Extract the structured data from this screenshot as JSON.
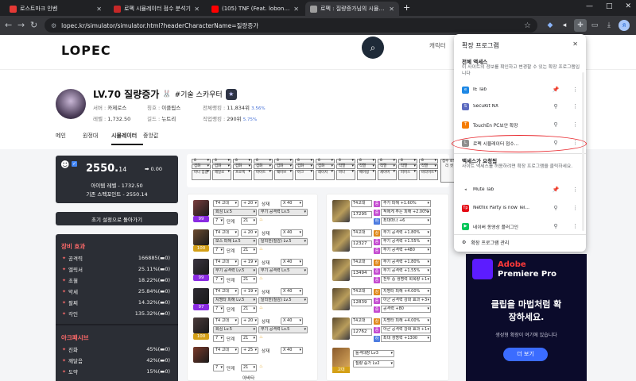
{
  "browser": {
    "tabs": [
      {
        "title": "로스트마크 인벤",
        "active": false,
        "color": "#e53935"
      },
      {
        "title": "로펙 시뮬레이터 점수 분석기",
        "active": false,
        "color": "#c62828"
      },
      {
        "title": "(105) TNF (Feat. lobonabea...",
        "active": false,
        "color": "#ff0000"
      },
      {
        "title": "로펙 : 질량증가님의 시뮬레이터",
        "active": true,
        "color": "#9e9e9e"
      }
    ],
    "url": "lopec.kr/simulator/simulator.html?headerCharacterName=질량증가",
    "new_tab": "+",
    "window_controls": {
      "min": "—",
      "max": "□",
      "close": "✕"
    },
    "profile_initial": "Я"
  },
  "site": {
    "logo": "LOPEC",
    "search_placeholder": "캐릭터"
  },
  "profile": {
    "level_name": "LV.70 질량증가",
    "bunny": "🐰",
    "job": "#기술 스카우터",
    "server_k": "서버 :",
    "server_v": "카제로스",
    "title_k": "칭호 :",
    "title_v": "이클립스",
    "total_k": "전체랭킹 :",
    "total_v": "11,834위",
    "total_pct": "3.56%",
    "level_k": "레벨 :",
    "level_v": "1,732.50",
    "guild_k": "길드 :",
    "guild_v": "뉴트리",
    "job_rank_k": "직업랭킹 :",
    "job_rank_v": "290위",
    "job_rank_pct": "5.75%"
  },
  "nav_tabs": [
    "메인",
    "원정대",
    "시뮬레이터",
    "중앙값"
  ],
  "score_card": {
    "score_int": "2550.",
    "score_dec": "14",
    "delta": "➡ 0.00",
    "item_level": "아이템 레벨 - 1732.50",
    "base_points": "기존 스펙포인트 - 2550.14",
    "checkbox": "✓"
  },
  "reset_button": "초기 설정으로 돌아가기",
  "stats": {
    "equip_title": "장비 효과",
    "equip": [
      {
        "label": "공격력",
        "value": "166885(▬0)"
      },
      {
        "label": "엘릭서",
        "value": "25.11%(▬0)"
      },
      {
        "label": "초월",
        "value": "18.22%(▬0)"
      },
      {
        "label": "악세",
        "value": "25.84%(▬0)"
      },
      {
        "label": "팔찌",
        "value": "14.32%(▬0)"
      },
      {
        "label": "각인",
        "value": "135.32%(▬0)"
      }
    ],
    "ark_title": "아크패시브",
    "ark": [
      {
        "label": "진화",
        "value": "45%(▬0)"
      },
      {
        "label": "깨달음",
        "value": "42%(▬0)"
      },
      {
        "label": "도약",
        "value": "15%(▬0)"
      }
    ]
  },
  "gems": {
    "levels": [
      "8",
      "8",
      "8",
      "8",
      "8",
      "8",
      "8",
      "8",
      "8",
      "8",
      "8",
      "8"
    ],
    "types": [
      "겁화",
      "겁화",
      "겁화",
      "겁화",
      "겁화",
      "겁화",
      "겁화",
      "작열",
      "작열",
      "작열",
      "작열",
      "작열"
    ],
    "skills": [
      "마나 집결",
      "헤일로",
      "프로젝",
      "마이트",
      "웨이브",
      "아크",
      "레이저",
      "마나",
      "베어링",
      "세이버",
      "피어스",
      "바라이트"
    ],
    "last": "점수 로드 리 셋"
  },
  "equipment": [
    {
      "tier": "T4 고대",
      "plus": "+ 20",
      "slot": "상재",
      "xval": "X 40",
      "o1": "회심 Lv.5",
      "o2": "무기 공격력 Lv.5",
      "stage": "7",
      "step_lbl": "단계",
      "step": "21",
      "lvl": "99",
      "color": "#8a2be2",
      "icon": "#7a3d3d"
    },
    {
      "tier": "T4 고대",
      "plus": "+ 20",
      "slot": "상재",
      "xval": "X 40",
      "o1": "보스 피해 Lv.5",
      "o2": "탈리한(질감) Lv.5",
      "stage": "7",
      "step_lbl": "단계",
      "step": "21",
      "lvl": "100",
      "color": "#d4a017",
      "icon": "#6b4a2e"
    },
    {
      "tier": "T4 고대",
      "plus": "+ 19",
      "slot": "상재",
      "xval": "X 40",
      "o1": "무기 공격력 Lv.5",
      "o2": "무기 공격력 Lv.5",
      "stage": "7",
      "step_lbl": "단계",
      "step": "21",
      "lvl": "99",
      "color": "#8a2be2",
      "icon": "#3b3540"
    },
    {
      "tier": "T4 고대",
      "plus": "+ 19",
      "slot": "상재",
      "xval": "X 40",
      "o1": "치명타 피해 Lv.5",
      "o2": "탈리한(질감) Lv.5",
      "stage": "7",
      "step_lbl": "단계",
      "step": "21",
      "lvl": "97",
      "color": "#8a2be2",
      "icon": "#2e2a32"
    },
    {
      "tier": "T4 고대",
      "plus": "+ 20",
      "slot": "상재",
      "xval": "X 40",
      "o1": "회심 Lv.5",
      "o2": "무기 공격력 Lv.5",
      "stage": "7",
      "step_lbl": "단계",
      "step": "21",
      "lvl": "100",
      "color": "#d4a017",
      "icon": "#4a3a3a"
    },
    {
      "tier": "T4 고대",
      "plus": "+ 25",
      "slot": "상재",
      "xval": "X 40",
      "o1": "",
      "o2": "",
      "stage": "7",
      "step_lbl": "단계",
      "step": "21",
      "lvl": "",
      "color": "#d4a017",
      "icon": "#7a3a2a"
    }
  ],
  "weapon_footer": "아바타",
  "accessories": [
    {
      "tier": "T4고대",
      "num": "17295",
      "opts": [
        {
          "g": "중",
          "c": "#c44bd0",
          "t": "추가 피해 +1.60%"
        },
        {
          "g": "중",
          "c": "#c44bd0",
          "t": "적에게 주는 피해 +2.00%"
        },
        {
          "g": "하",
          "c": "#4c7be0",
          "t": "최대마나 +6"
        }
      ]
    },
    {
      "tier": "T4고대",
      "num": "12327",
      "opts": [
        {
          "g": "상",
          "c": "#e08a1e",
          "t": "무기 공격력 +1.80%"
        },
        {
          "g": "중",
          "c": "#c44bd0",
          "t": "무기 공격력 +1.55%"
        },
        {
          "g": "중",
          "c": "#c44bd0",
          "t": "무기 공격력 +480"
        }
      ]
    },
    {
      "tier": "T4고대",
      "num": "13494",
      "opts": [
        {
          "g": "상",
          "c": "#e08a1e",
          "t": "무기 공격력 +1.80%"
        },
        {
          "g": "중",
          "c": "#c44bd0",
          "t": "무기 공격력 +1.55%"
        },
        {
          "g": "중",
          "c": "#c44bd0",
          "t": "전투 중 생명력 회복량 +1"
        }
      ]
    },
    {
      "tier": "T4고대",
      "num": "12839",
      "opts": [
        {
          "g": "상",
          "c": "#e08a1e",
          "t": "치명타 피해 +4.00%"
        },
        {
          "g": "중",
          "c": "#c44bd0",
          "t": "아군 공격력 강화 효과 +3"
        },
        {
          "g": "중",
          "c": "#c44bd0",
          "t": "공격력 +80"
        }
      ]
    },
    {
      "tier": "T4고대",
      "num": "12762",
      "opts": [
        {
          "g": "상",
          "c": "#e08a1e",
          "t": "치명타 피해 +4.00%"
        },
        {
          "g": "중",
          "c": "#c44bd0",
          "t": "아군 공격력 강화 효과 +1"
        },
        {
          "g": "하",
          "c": "#4c7be0",
          "t": "최대 생명력 +1300"
        }
      ]
    }
  ],
  "bracelet": {
    "o1": "돌격대장 Lv3",
    "o2": "질량 증가 Lv2",
    "tier": "고대"
  },
  "ad": {
    "brand": "Adobe",
    "product": "Premiere Pro",
    "headline1": "클립을 마법처럼 확",
    "headline2": "장하세요.",
    "sub": "생성형 확장이 여기에 있습니다",
    "button": "더 보기"
  },
  "extensions": {
    "title": "확장 프로그램",
    "full_access": "전체 액세스",
    "full_desc": "이 사이트의 정보를 확인하고 변경할 수 있는 확장 프로그램입니다",
    "full_list": [
      {
        "name": "IE Tab",
        "color": "#1e88e5",
        "pinned": true
      },
      {
        "name": "SecuKit NX",
        "color": "#5c6bc0",
        "pinned": false
      },
      {
        "name": "TouchEn PC보안 확장",
        "color": "#f57c00",
        "pinned": false
      },
      {
        "name": "로펙 시뮬레이터 점수...",
        "color": "#8e8e8e",
        "pinned": false
      }
    ],
    "request_title": "액세스가 요청됨",
    "request_desc": "사이트 액세스를 허용하려면 확장 프로그램을 클릭하세요.",
    "request_list": [
      {
        "name": "Mute Tab",
        "color": "#616161",
        "pinned": true
      },
      {
        "name": "Netflix Party is now Tel...",
        "color": "#e50914",
        "pinned": false
      },
      {
        "name": "네이버 동영상 플러그인",
        "color": "#03c75a",
        "pinned": false
      }
    ],
    "manage": "확장 프로그램 관리"
  }
}
